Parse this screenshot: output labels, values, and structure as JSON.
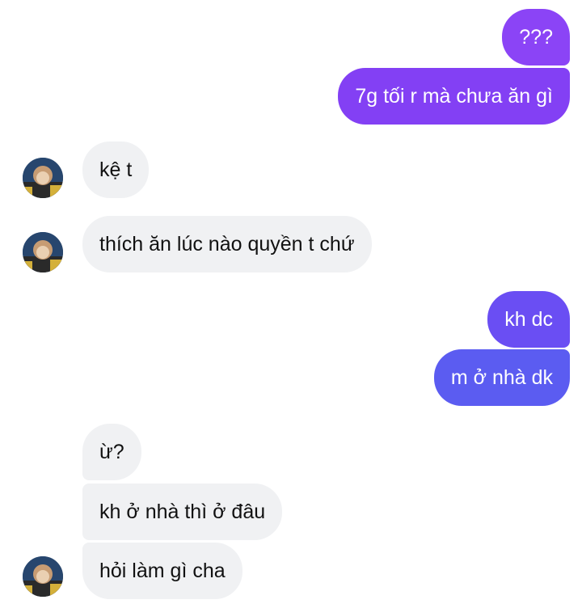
{
  "conversation": {
    "outgoing_colors": {
      "top": "#8a43f5",
      "mid": "#6d4cf2",
      "bottom": "#5a5cf0"
    },
    "incoming_color": "#f0f1f3",
    "avatar_icon": "user-avatar-icon",
    "messages": [
      {
        "from": "me",
        "text": "???"
      },
      {
        "from": "me",
        "text": "7g tối r mà chưa ăn gì"
      },
      {
        "from": "them",
        "text": "kệ t"
      },
      {
        "from": "them",
        "text": "thích ăn lúc nào quyền t chứ"
      },
      {
        "from": "me",
        "text": "kh dc"
      },
      {
        "from": "me",
        "text": "m ở nhà dk"
      },
      {
        "from": "them",
        "text": "ừ?"
      },
      {
        "from": "them",
        "text": "kh ở nhà thì ở đâu"
      },
      {
        "from": "them",
        "text": "hỏi làm gì cha"
      }
    ]
  }
}
